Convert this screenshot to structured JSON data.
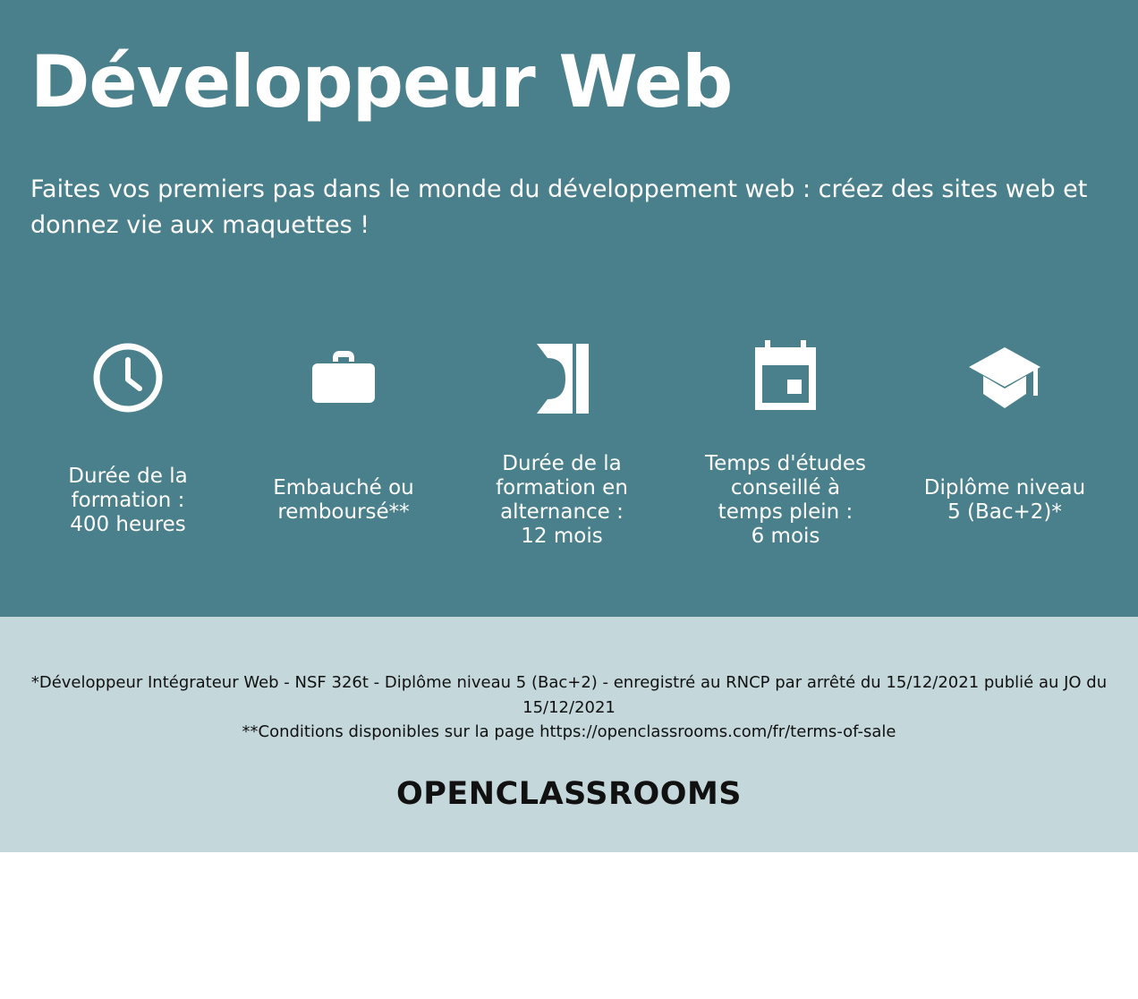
{
  "colors": {
    "hero_background": "#4a808b",
    "footer_background": "#c4d7db",
    "text_light": "#ffffff",
    "text_dark": "#111111"
  },
  "hero": {
    "title": "Développeur Web",
    "subtitle": "Faites vos premiers pas dans le monde du développement web : créez des sites web et donnez vie aux maquettes !"
  },
  "features": [
    {
      "icon": "clock-icon",
      "label": "Durée de la\nformation :\n400 heures"
    },
    {
      "icon": "briefcase-icon",
      "label": "Embauché ou\nremboursé**"
    },
    {
      "icon": "openclassrooms-logo-icon",
      "label": "Durée de la\nformation en\nalternance :\n12 mois"
    },
    {
      "icon": "calendar-icon",
      "label": "Temps d'études\nconseillé à\ntemps plein :\n6 mois"
    },
    {
      "icon": "graduation-cap-icon",
      "label": "Diplôme niveau\n5 (Bac+2)*"
    }
  ],
  "footer": {
    "note_line1": "*Développeur Intégrateur Web - NSF 326t - Diplôme niveau 5 (Bac+2) - enregistré au RNCP par arrêté du 15/12/2021 publié au JO du 15/12/2021",
    "note_line2": "**Conditions disponibles sur la page https://openclassrooms.com/fr/terms-of-sale",
    "logo_text": "OPENCLASSROOMS"
  }
}
